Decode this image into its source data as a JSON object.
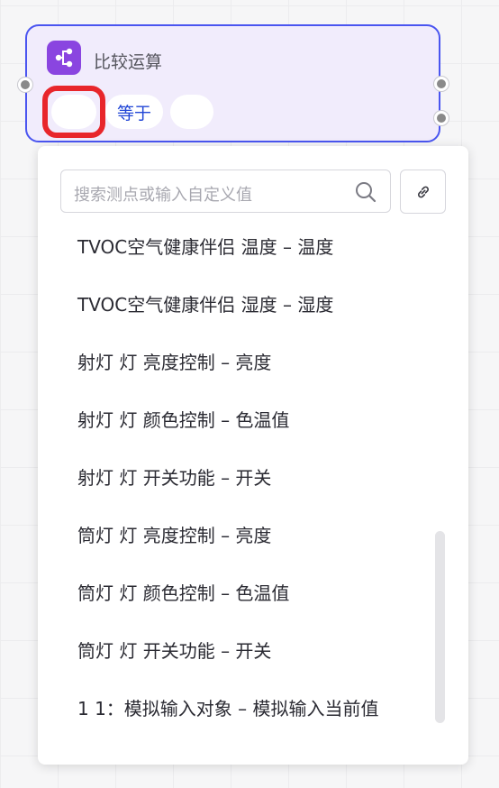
{
  "node": {
    "title": "比较运算",
    "icon": "share-nodes-icon",
    "operator": "等于",
    "accent_color": "#4a55f0",
    "icon_color": "#8a45e0",
    "highlight_color": "#e8262b"
  },
  "dropdown": {
    "search": {
      "placeholder": "搜索测点或输入自定义值",
      "value": ""
    },
    "items": [
      {
        "label": "TVOC空气健康伴侣 温度 – 温度"
      },
      {
        "label": "TVOC空气健康伴侣 湿度 – 湿度"
      },
      {
        "label": "射灯 灯 亮度控制 – 亮度"
      },
      {
        "label": "射灯 灯 颜色控制 – 色温值"
      },
      {
        "label": "射灯 灯 开关功能 – 开关"
      },
      {
        "label": "筒灯 灯 亮度控制 – 亮度"
      },
      {
        "label": "筒灯 灯 颜色控制 – 色温值"
      },
      {
        "label": "筒灯 灯 开关功能 – 开关"
      },
      {
        "label": "1 1：模拟输入对象 – 模拟输入当前值"
      }
    ]
  }
}
